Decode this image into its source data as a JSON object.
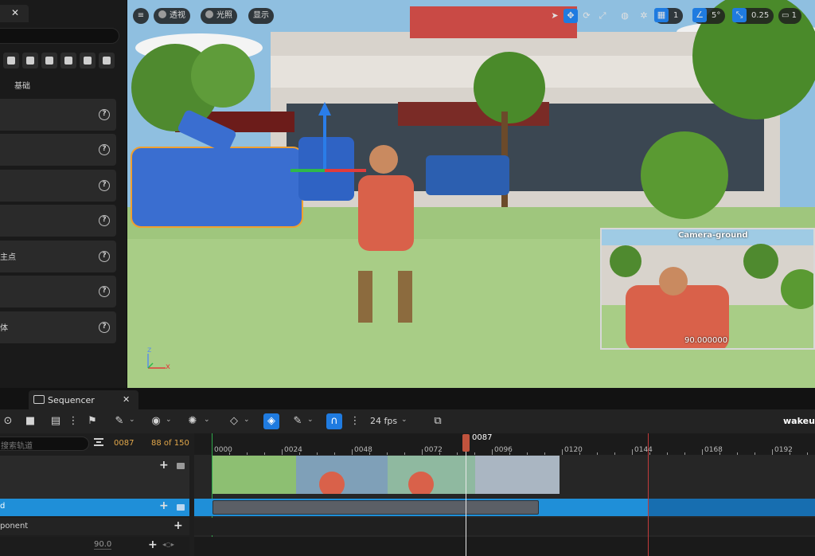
{
  "left_panel": {
    "basic_label": "基础",
    "rows": [
      {
        "label": ""
      },
      {
        "label": ""
      },
      {
        "label": ""
      },
      {
        "label": ""
      },
      {
        "label": "主点"
      },
      {
        "label": ""
      },
      {
        "label": "体"
      }
    ]
  },
  "viewport": {
    "view_mode": "透视",
    "lighting": "光照",
    "show": "显示",
    "grid_size": "1",
    "angle_snap": "5°",
    "scale_snap": "0.25",
    "camera_speed": "1",
    "axis_x": "x",
    "axis_z": "z",
    "pip": {
      "title": "Camera-ground",
      "value": "90.000000"
    },
    "icons": [
      "select-icon",
      "translate-icon",
      "rotate-icon",
      "scale-icon",
      "world-icon",
      "surface-snap-icon",
      "grid-snap-icon",
      "angle-snap-icon",
      "scale-snap-icon",
      "camera-speed-icon"
    ]
  },
  "sequencer": {
    "tab_label": "Sequencer",
    "fps": "24 fps",
    "sequence_name": "wakeup",
    "search_placeholder": "搜索轨道",
    "current_frame": "0087",
    "frame_count": "88 of 150",
    "playhead_label": "0087",
    "ticks": [
      "0000",
      "0024",
      "0048",
      "0072",
      "0096",
      "0120",
      "0144",
      "0168",
      "0192"
    ],
    "tracks": [
      {
        "label": "",
        "selected": false
      },
      {
        "label": "d",
        "selected": true
      },
      {
        "label": "ponent",
        "selected": false
      },
      {
        "label": "90.0",
        "selected": false
      }
    ]
  },
  "colors": {
    "accent": "#1f7be0",
    "selection": "#1f8fd8",
    "playhead": "#c0533d",
    "frame_text": "#e3a84a",
    "end_marker": "#c23b3b",
    "start_marker": "#2fa84a"
  }
}
